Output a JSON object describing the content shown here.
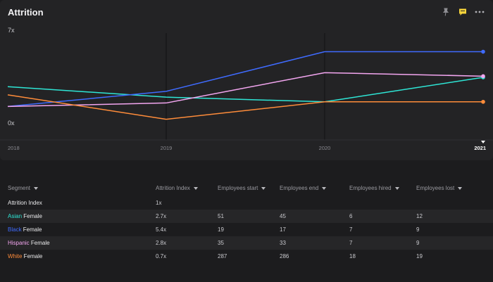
{
  "card": {
    "title": "Attrition",
    "icons": [
      "pin-icon",
      "comment-icon",
      "more-icon"
    ],
    "comment_color": "#f5d33b"
  },
  "chart_data": {
    "type": "line",
    "title": "Attrition",
    "x": [
      "2018",
      "2019",
      "2020",
      "2021"
    ],
    "xlabel": "",
    "ylabel": "",
    "ylim": [
      0,
      7
    ],
    "ytick_labels": [
      "7x",
      "0x"
    ],
    "grid": true,
    "selected_x": "2021",
    "series": [
      {
        "name": "Asian Female",
        "color": "#2ee6d6",
        "values": [
          2.4,
          1.5,
          1.1,
          3.2
        ]
      },
      {
        "name": "Black Female",
        "color": "#3f6bff",
        "values": [
          0.7,
          2.0,
          5.4,
          5.4
        ]
      },
      {
        "name": "Hispanic Female",
        "color": "#f3a6f0",
        "values": [
          0.7,
          1.0,
          3.6,
          3.3
        ]
      },
      {
        "name": "White Female",
        "color": "#ff8c3a",
        "values": [
          1.7,
          -0.4,
          1.1,
          1.1
        ]
      }
    ]
  },
  "table": {
    "headers": [
      "Segment",
      "Attrition Index",
      "Employees start",
      "Employees end",
      "Employees hired",
      "Employees lost"
    ],
    "rows": [
      {
        "group": "",
        "segment": "Attrition Index",
        "group_color": "#e8e8ea",
        "cells": [
          "1x",
          "",
          "",
          "",
          ""
        ]
      },
      {
        "group": "Asian",
        "segment": " Female",
        "group_color": "#2ee6d6",
        "cells": [
          "2.7x",
          "51",
          "45",
          "6",
          "12"
        ]
      },
      {
        "group": "Black",
        "segment": " Female",
        "group_color": "#3f6bff",
        "cells": [
          "5.4x",
          "19",
          "17",
          "7",
          "9"
        ]
      },
      {
        "group": "Hispanic",
        "segment": " Female",
        "group_color": "#f3a6f0",
        "cells": [
          "2.8x",
          "35",
          "33",
          "7",
          "9"
        ]
      },
      {
        "group": "White",
        "segment": " Female",
        "group_color": "#ff8c3a",
        "cells": [
          "0.7x",
          "287",
          "286",
          "18",
          "19"
        ]
      }
    ]
  }
}
